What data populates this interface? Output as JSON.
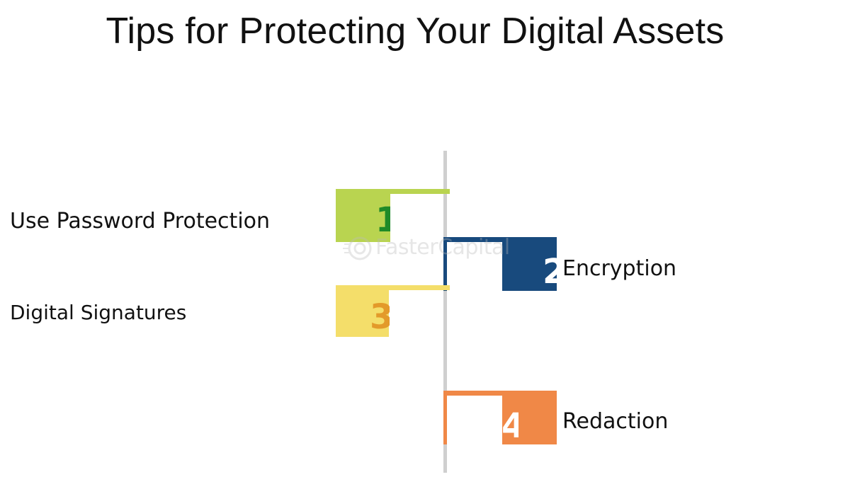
{
  "title": "Tips for Protecting Your Digital Assets",
  "steps": [
    {
      "number": "1",
      "label": "Use Password Protection",
      "color": "#b9d450",
      "number_color": "#1e8a28"
    },
    {
      "number": "2",
      "label": "Encryption",
      "color": "#184a7d",
      "number_color": "#ffffff"
    },
    {
      "number": "3",
      "label": "Digital Signatures",
      "color": "#f4de6a",
      "number_color": "#e39a2a"
    },
    {
      "number": "4",
      "label": "Redaction",
      "color": "#f08847",
      "number_color": "#ffffff"
    }
  ],
  "axis_color": "#cfcfcf",
  "watermark": "FasterCapital"
}
